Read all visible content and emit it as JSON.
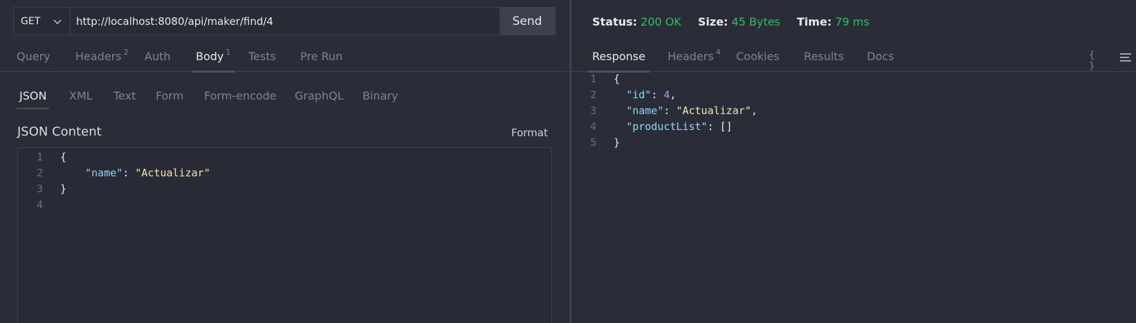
{
  "request": {
    "method": "GET",
    "url": "http://localhost:8080/api/maker/find/4",
    "send_label": "Send"
  },
  "request_tabs": [
    {
      "label": "Query",
      "badge": ""
    },
    {
      "label": "Headers",
      "badge": "2"
    },
    {
      "label": "Auth",
      "badge": ""
    },
    {
      "label": "Body",
      "badge": "1"
    },
    {
      "label": "Tests",
      "badge": ""
    },
    {
      "label": "Pre Run",
      "badge": ""
    }
  ],
  "active_request_tab": "Body",
  "body_types": [
    "JSON",
    "XML",
    "Text",
    "Form",
    "Form-encode",
    "GraphQL",
    "Binary"
  ],
  "active_body_type": "JSON",
  "json_content_label": "JSON Content",
  "format_label": "Format",
  "request_body_lines": [
    {
      "n": "1",
      "text": "{"
    },
    {
      "n": "2",
      "key": "\"name\"",
      "sep": ": ",
      "value": "\"Actualizar\""
    },
    {
      "n": "3",
      "text": "}"
    },
    {
      "n": "4",
      "text": ""
    }
  ],
  "response_status": {
    "status_label": "Status:",
    "status_value": "200 OK",
    "size_label": "Size:",
    "size_value": "45 Bytes",
    "time_label": "Time:",
    "time_value": "79 ms"
  },
  "response_tabs": [
    {
      "label": "Response",
      "badge": ""
    },
    {
      "label": "Headers",
      "badge": "4"
    },
    {
      "label": "Cookies",
      "badge": ""
    },
    {
      "label": "Results",
      "badge": ""
    },
    {
      "label": "Docs",
      "badge": ""
    }
  ],
  "active_response_tab": "Response",
  "response_lines": [
    {
      "n": "1",
      "text": "{"
    },
    {
      "n": "2",
      "key": "\"id\"",
      "sep": ": ",
      "num": "4",
      "tail": ","
    },
    {
      "n": "3",
      "key": "\"name\"",
      "sep": ": ",
      "value": "\"Actualizar\"",
      "tail": ","
    },
    {
      "n": "4",
      "key": "\"productList\"",
      "sep": ": ",
      "punct": "[]"
    },
    {
      "n": "5",
      "text": "}"
    }
  ],
  "icons": {
    "braces": "{ }",
    "menu": "menu-icon"
  },
  "colors": {
    "background": "#2a2c38",
    "success": "#2fbd63",
    "key": "#8fd6f0",
    "string": "#eee8a9",
    "number": "#b393e8"
  }
}
